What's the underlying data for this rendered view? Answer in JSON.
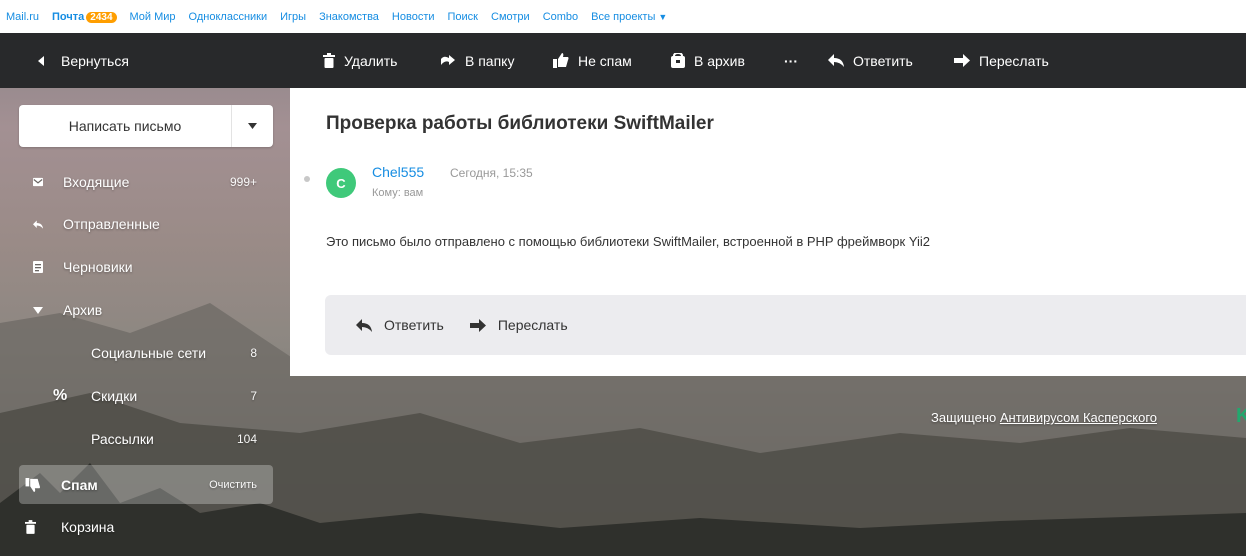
{
  "portal": {
    "links": [
      "Mail.ru",
      "Почта",
      "Мой Мир",
      "Одноклассники",
      "Игры",
      "Знакомства",
      "Новости",
      "Поиск",
      "Смотри",
      "Combo"
    ],
    "mail_badge": "2434",
    "all_projects": "Все проекты"
  },
  "toolbar": {
    "back": "Вернуться",
    "delete": "Удалить",
    "to_folder": "В папку",
    "not_spam": "Не спам",
    "archive": "В архив",
    "more": "···",
    "reply": "Ответить",
    "forward": "Переслать"
  },
  "sidebar": {
    "compose": "Написать письмо",
    "folders": [
      {
        "name": "Входящие",
        "count": "999+",
        "icon": "inbox-icon"
      },
      {
        "name": "Отправленные",
        "count": "",
        "icon": "sent-icon"
      },
      {
        "name": "Черновики",
        "count": "",
        "icon": "drafts-icon"
      },
      {
        "name": "Архив",
        "count": "",
        "icon": "caret-down-icon"
      },
      {
        "name": "Социальные сети",
        "count": "8",
        "icon": "people-icon"
      },
      {
        "name": "Скидки",
        "count": "7",
        "icon": "percent-icon"
      },
      {
        "name": "Рассылки",
        "count": "104",
        "icon": "newsletter-icon"
      },
      {
        "name": "Спам",
        "count": "Очистить",
        "icon": "spam-icon"
      },
      {
        "name": "Корзина",
        "count": "",
        "icon": "trash-icon"
      }
    ]
  },
  "letter": {
    "subject": "Проверка работы библиотеки SwiftMailer",
    "avatar_letter": "C",
    "sender": "Chel555",
    "date": "Сегодня, 15:35",
    "to": "Кому: вам",
    "body": "Это письмо было отправлено с помощью библиотеки SwiftMailer, встроенной в PHP фреймворк Yii2",
    "reply": "Ответить",
    "forward": "Переслать"
  },
  "footer": {
    "protected": "Защищено",
    "antivirus_link": "Антивирусом Касперского",
    "logo_letter": "K"
  },
  "colors": {
    "accent": "#168de2",
    "toolbar_bg": "#28292b",
    "avatar": "#3fc97a",
    "badge": "#ff9e00"
  }
}
